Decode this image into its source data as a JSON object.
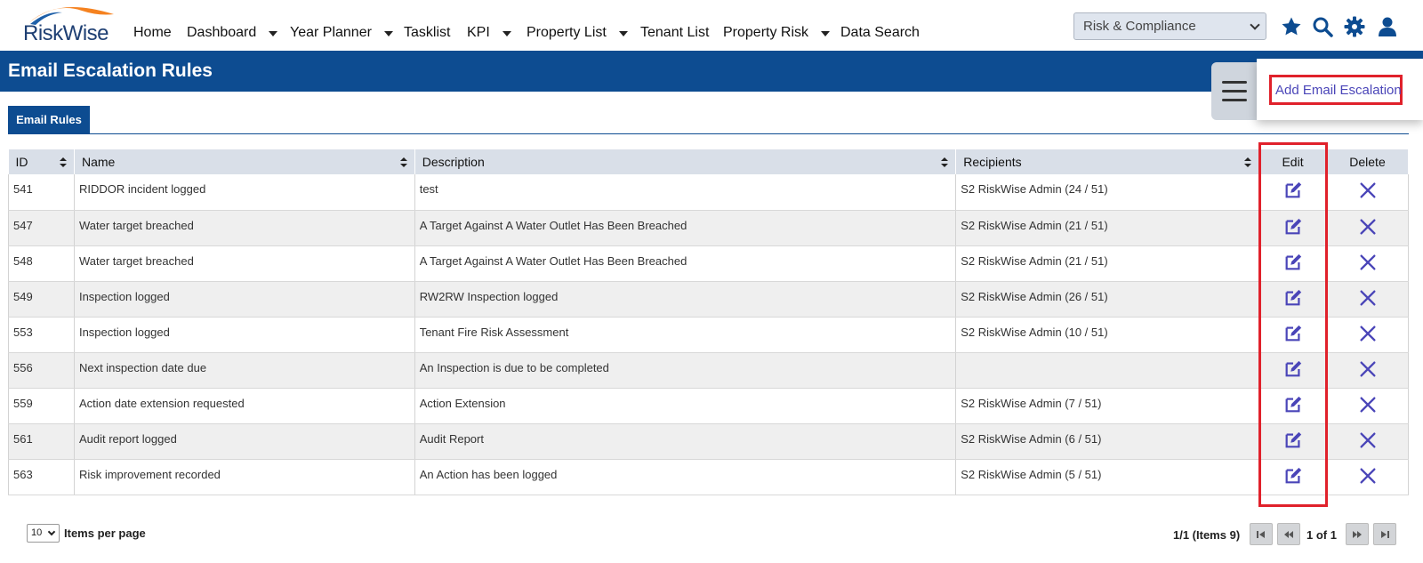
{
  "nav": {
    "logo": "RiskWise",
    "items": [
      {
        "label": "Home",
        "dropdown": false
      },
      {
        "label": "Dashboard",
        "dropdown": true
      },
      {
        "label": "Year Planner",
        "dropdown": true
      },
      {
        "label": "Tasklist",
        "dropdown": false
      },
      {
        "label": "KPI",
        "dropdown": true
      },
      {
        "label": "Property List",
        "dropdown": true
      },
      {
        "label": "Tenant List",
        "dropdown": false
      },
      {
        "label": "Property Risk",
        "dropdown": true
      },
      {
        "label": "Data Search",
        "dropdown": false
      }
    ],
    "role_select": "Risk & Compliance",
    "icons": [
      "star-icon",
      "search-icon",
      "gear-icon",
      "user-icon"
    ]
  },
  "page": {
    "title": "Email Escalation Rules",
    "tab": "Email Rules",
    "add_link": "Add Email Escalation"
  },
  "table": {
    "columns": [
      "ID",
      "Name",
      "Description",
      "Recipients",
      "Edit",
      "Delete"
    ],
    "rows": [
      {
        "id": "541",
        "name": "RIDDOR incident logged",
        "description": "test",
        "recipients": "S2 RiskWise Admin (24 / 51)"
      },
      {
        "id": "547",
        "name": "Water target breached",
        "description": "A Target Against A Water Outlet Has Been Breached",
        "recipients": "S2 RiskWise Admin (21 / 51)"
      },
      {
        "id": "548",
        "name": "Water target breached",
        "description": "A Target Against A Water Outlet Has Been Breached",
        "recipients": "S2 RiskWise Admin (21 / 51)"
      },
      {
        "id": "549",
        "name": "Inspection logged",
        "description": "RW2RW Inspection logged",
        "recipients": "S2 RiskWise Admin (26 / 51)"
      },
      {
        "id": "553",
        "name": "Inspection logged",
        "description": "Tenant Fire Risk Assessment",
        "recipients": "S2 RiskWise Admin (10 / 51)"
      },
      {
        "id": "556",
        "name": "Next inspection date due",
        "description": "An Inspection is due to be completed",
        "recipients": ""
      },
      {
        "id": "559",
        "name": "Action date extension requested",
        "description": "Action Extension",
        "recipients": "S2 RiskWise Admin (7 / 51)"
      },
      {
        "id": "561",
        "name": "Audit report logged",
        "description": "Audit Report",
        "recipients": "S2 RiskWise Admin (6 / 51)"
      },
      {
        "id": "563",
        "name": "Risk improvement recorded",
        "description": "An Action has been logged",
        "recipients": "S2 RiskWise Admin (5 / 51)"
      }
    ]
  },
  "pagination": {
    "per_page": "10",
    "per_page_label": "Items per page",
    "summary": "1/1 (Items 9)",
    "page_label": "1 of 1"
  },
  "colors": {
    "brand_blue": "#0d4c91",
    "action_purple": "#4a45b8",
    "highlight_red": "#e0212b"
  }
}
